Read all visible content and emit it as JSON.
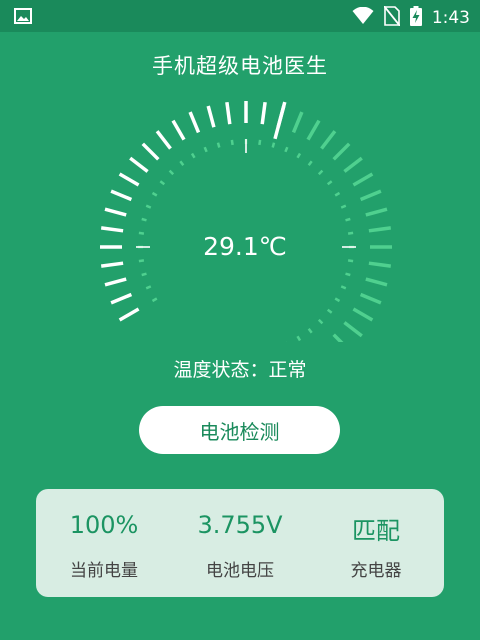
{
  "status_bar": {
    "time": "1:43",
    "icons": [
      "image-icon",
      "wifi-icon",
      "no-sim-icon",
      "battery-charging-icon"
    ]
  },
  "app": {
    "title": "手机超级电池医生"
  },
  "gauge": {
    "temperature": "29.1℃",
    "level": 0.45
  },
  "status": {
    "text": "温度状态：正常"
  },
  "actions": {
    "check_button": "电池检测"
  },
  "stats": [
    {
      "value": "100%",
      "label": "当前电量"
    },
    {
      "value": "3.755V",
      "label": "电池电压"
    },
    {
      "value": "匹配",
      "label": "充电器"
    }
  ],
  "colors": {
    "background": "#22a06b",
    "status_bar": "#1a8a5b",
    "card": "#d8ede3",
    "accent_text": "#1b9462",
    "gauge_active": "#ffffff",
    "gauge_inactive": "#4fd08f"
  }
}
